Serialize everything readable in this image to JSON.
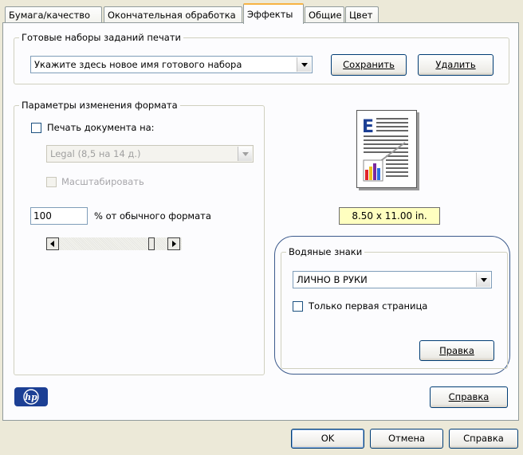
{
  "tabs": [
    {
      "label": "Бумага/качество"
    },
    {
      "label": "Окончательная обработка"
    },
    {
      "label": "Эффекты"
    },
    {
      "label": "Общие"
    },
    {
      "label": "Цвет"
    }
  ],
  "presets": {
    "legend": "Готовые наборы заданий печати",
    "combo_value": "Укажите здесь новое имя готового набора",
    "save_label": "Сохранить",
    "delete_label": "Удалить"
  },
  "resize": {
    "legend": "Параметры изменения формата",
    "print_on_label": "Печать документа на:",
    "paper_value": "Legal (8,5 на 14 д.)",
    "scale_label": "Масштабировать",
    "percent_value": "100",
    "percent_label": "% от обычного формата"
  },
  "preview": {
    "size_label": "8.50 x 11.00 in."
  },
  "watermarks": {
    "legend": "Водяные знаки",
    "combo_value": "ЛИЧНО В РУКИ",
    "first_page_label": "Только первая страница",
    "edit_label": "Правка"
  },
  "panel": {
    "help_label": "Справка"
  },
  "dialog": {
    "ok_label": "OK",
    "cancel_label": "Отмена",
    "help_label": "Справка"
  },
  "colors": {
    "size_badge_bg": "#ffffc0",
    "highlight_ring": "#3c5a8c",
    "hp_logo": "#1c3f94"
  }
}
